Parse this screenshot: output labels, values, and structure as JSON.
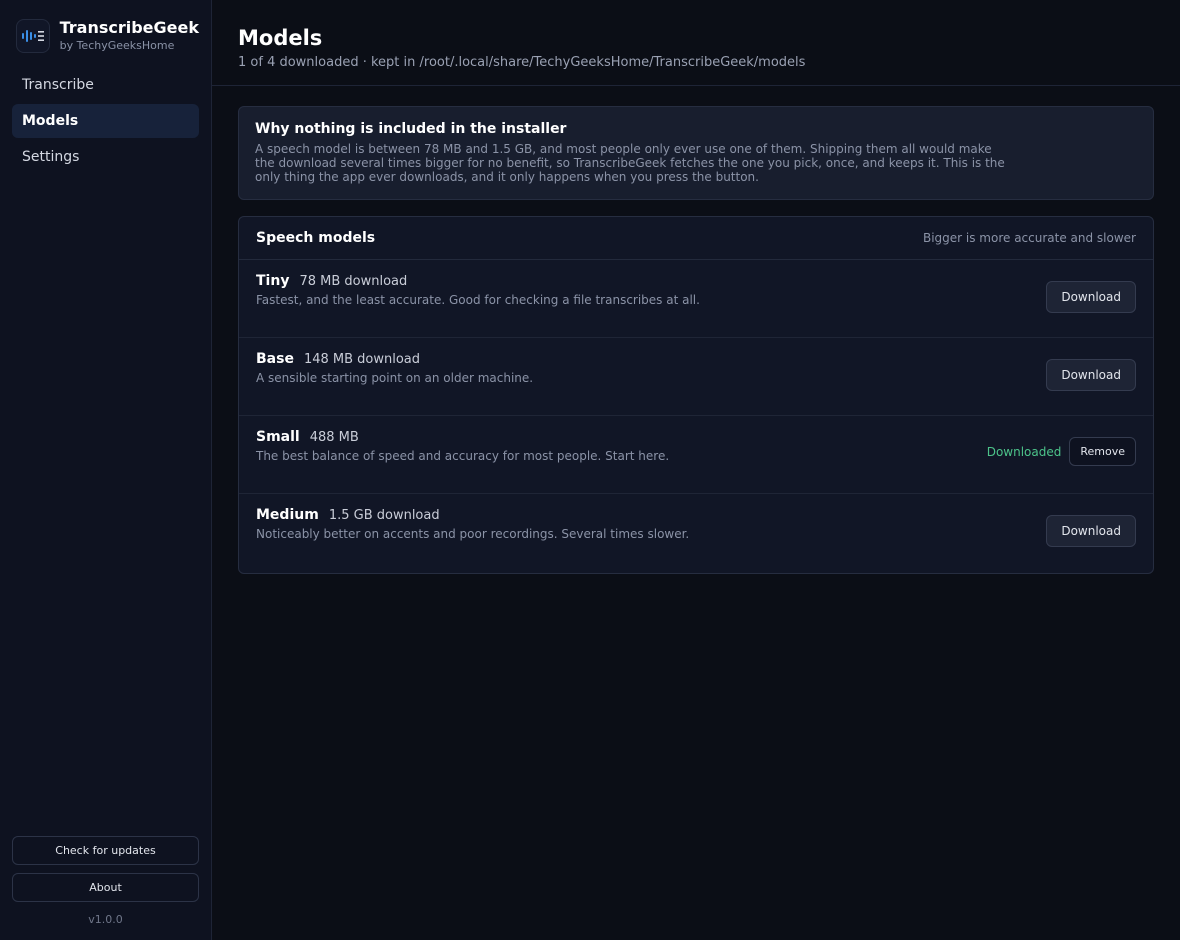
{
  "brand": {
    "name": "TranscribeGeek",
    "sub": "by TechyGeeksHome",
    "icon": "waveform-icon",
    "accent": "#3a8ee6"
  },
  "nav": {
    "items": [
      {
        "label": "Transcribe",
        "active": false
      },
      {
        "label": "Models",
        "active": true
      },
      {
        "label": "Settings",
        "active": false
      }
    ]
  },
  "sidebar_bottom": {
    "updates_label": "Check for updates",
    "about_label": "About",
    "version": "v1.0.0"
  },
  "header": {
    "title": "Models",
    "subtitle": "1 of 4 downloaded · kept in /root/.local/share/TechyGeeksHome/TranscribeGeek/models"
  },
  "notice": {
    "title": "Why nothing is included in the installer",
    "body": "A speech model is between 78 MB and 1.5 GB, and most people only ever use one of them. Shipping them all would make the download several times bigger for no benefit, so TranscribeGeek fetches the one you pick, once, and keeps it. This is the only thing the app ever downloads, and it only happens when you press the button."
  },
  "models_panel": {
    "title": "Speech models",
    "hint": "Bigger is more accurate and slower",
    "models": [
      {
        "name": "Tiny",
        "size": "78 MB download",
        "desc": "Fastest, and the least accurate. Good for checking a file transcribes at all.",
        "action": "Download"
      },
      {
        "name": "Base",
        "size": "148 MB download",
        "desc": "A sensible starting point on an older machine.",
        "action": "Download"
      },
      {
        "name": "Small",
        "size": "488 MB",
        "desc": "The best balance of speed and accuracy for most people. Start here.",
        "status": "Downloaded",
        "action": "Remove"
      },
      {
        "name": "Medium",
        "size": "1.5 GB download",
        "desc": "Noticeably better on accents and poor recordings. Several times slower.",
        "action": "Download"
      }
    ]
  },
  "colors": {
    "background": "#0b0e16",
    "sidebar": "#0e1220",
    "active_nav": "#17223a",
    "success": "#4cc38a"
  }
}
